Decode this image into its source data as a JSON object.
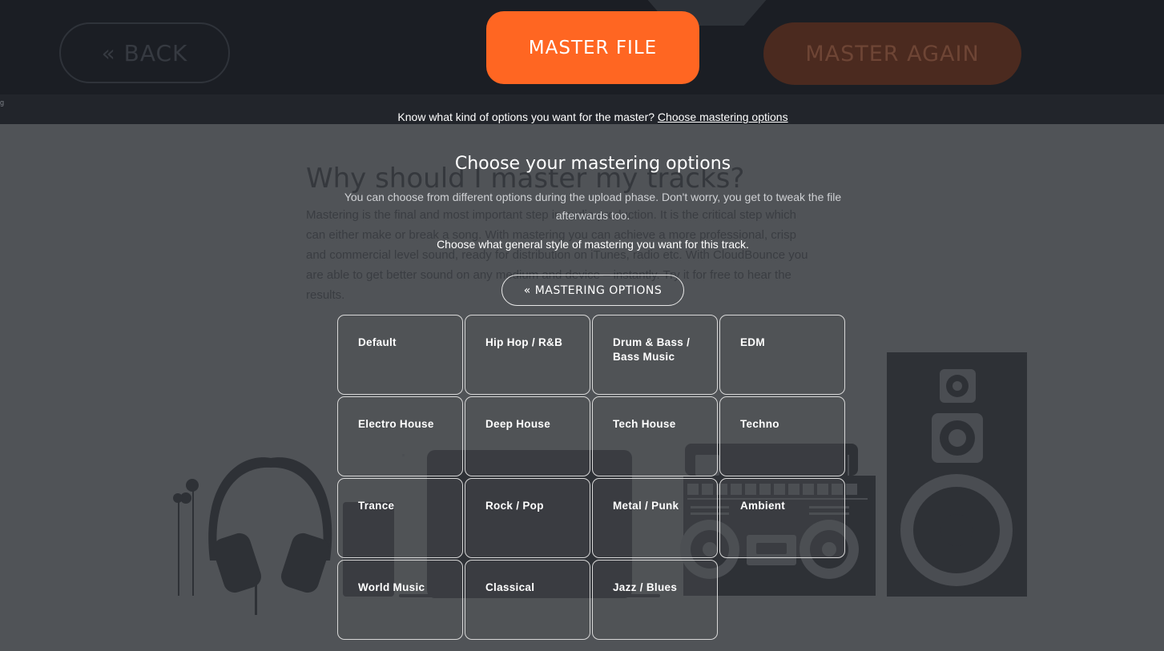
{
  "header": {
    "back_label": "« BACK",
    "master_file_label": "MASTER FILE",
    "master_again_label": "MASTER AGAIN",
    "stripe_fragment": "g"
  },
  "prompt": {
    "text": "Know what kind of options you want for the master?",
    "link": "Choose mastering options"
  },
  "background": {
    "heading": "Why should I master my tracks?",
    "paragraph": "Mastering is the final and most important step in audio production. It is the critical step which can either make or break a song. With mastering you can achieve a more professional, crisp and commercial level sound, ready for distribution on iTunes, radio etc. With CloudBounce you are able to get better sound on any medium and device – instantly. Try it for free to hear the results."
  },
  "panel": {
    "title": "Choose your mastering options",
    "subtitle": "You can choose from different options during the upload phase. Don't worry, you get to tweak the file afterwards too.",
    "instruction": "Choose what general style of mastering you want for this track.",
    "options_button": "« MASTERING OPTIONS",
    "genres": [
      "Default",
      "Hip Hop / R&B",
      "Drum & Bass / Bass Music",
      "EDM",
      "Electro House",
      "Deep House",
      "Tech House",
      "Techno",
      "Trance",
      "Rock / Pop",
      "Metal / Punk",
      "Ambient",
      "World Music",
      "Classical",
      "Jazz / Blues"
    ]
  },
  "colors": {
    "accent": "#ff6622",
    "topbar": "#1b1e24",
    "overlay": "#505357",
    "illustration": "#2e3136"
  }
}
